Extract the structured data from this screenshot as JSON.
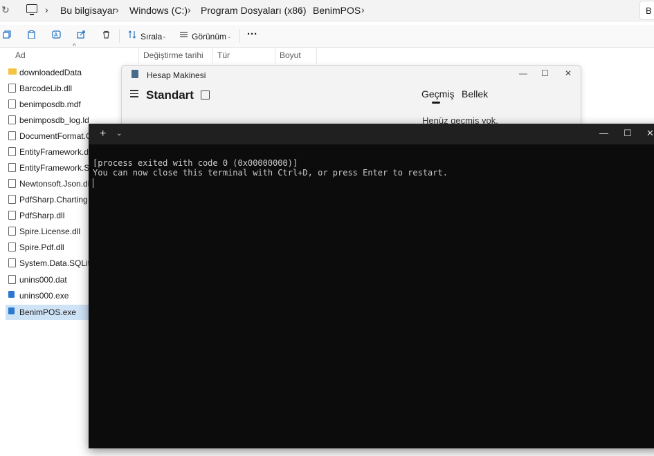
{
  "explorer": {
    "breadcrumb": [
      "Bu bilgisayar",
      "Windows (C:)",
      "Program Dosyaları (x86)",
      "BenimPOS"
    ],
    "search_partial": "B",
    "toolbar": {
      "sort_label": "Sırala",
      "view_label": "Görünüm",
      "more_label": "···"
    },
    "columns": [
      "Ad",
      "Değiştirme tarihi",
      "Tür",
      "Boyut"
    ],
    "files": [
      {
        "name": "downloadedData",
        "icon": "folder-icon"
      },
      {
        "name": "BarcodeLib.dll",
        "icon": "dll-file-icon"
      },
      {
        "name": "benimposdb.mdf",
        "icon": "file-icon"
      },
      {
        "name": "benimposdb_log.ldf",
        "icon": "file-icon"
      },
      {
        "name": "DocumentFormat.Op",
        "icon": "dll-file-icon"
      },
      {
        "name": "EntityFramework.dll",
        "icon": "dll-file-icon"
      },
      {
        "name": "EntityFramework.Sql",
        "icon": "dll-file-icon"
      },
      {
        "name": "Newtonsoft.Json.dll",
        "icon": "dll-file-icon"
      },
      {
        "name": "PdfSharp.Charting.dl",
        "icon": "dll-file-icon"
      },
      {
        "name": "PdfSharp.dll",
        "icon": "dll-file-icon"
      },
      {
        "name": "Spire.License.dll",
        "icon": "dll-file-icon"
      },
      {
        "name": "Spire.Pdf.dll",
        "icon": "dll-file-icon"
      },
      {
        "name": "System.Data.SQLite.c",
        "icon": "dll-file-icon"
      },
      {
        "name": "unins000.dat",
        "icon": "file-icon"
      },
      {
        "name": "unins000.exe",
        "icon": "exe-icon"
      },
      {
        "name": "BenimPOS.exe",
        "icon": "exe-icon",
        "selected": true
      }
    ]
  },
  "calculator": {
    "title": "Hesap Makinesi",
    "mode": "Standart",
    "tabs": [
      "Geçmiş",
      "Bellek"
    ],
    "history_empty": "Henüz geçmiş yok."
  },
  "terminal": {
    "lines": [
      "[process exited with code 0 (0x00000000)]",
      "You can now close this terminal with Ctrl+D, or press Enter to restart."
    ]
  }
}
